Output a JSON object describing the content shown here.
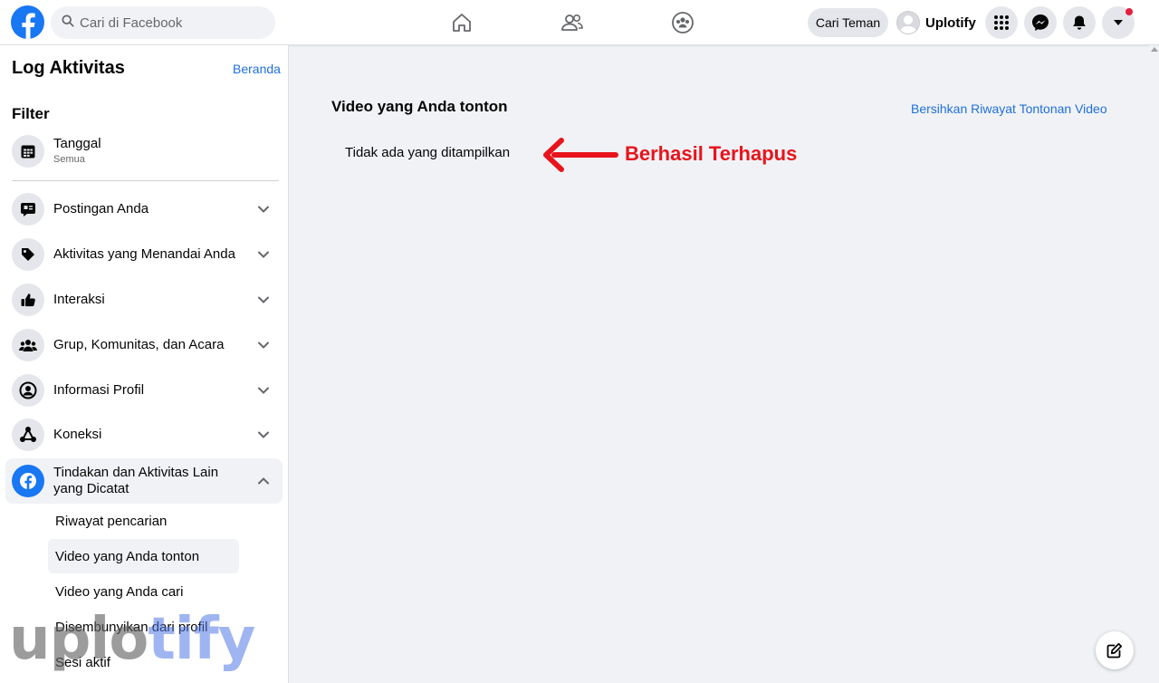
{
  "header": {
    "search_placeholder": "Cari di Facebook",
    "find_friends_label": "Cari Teman",
    "profile_name": "Uplotify",
    "nav": [
      "home-icon",
      "friends-icon",
      "groups-icon"
    ],
    "accent_color": "#1877f2",
    "notification_dot_color": "#e41e3f"
  },
  "sidebar": {
    "title": "Log Aktivitas",
    "home_link": "Beranda",
    "filter_title": "Filter",
    "date_filter": {
      "label": "Tanggal",
      "value": "Semua"
    },
    "categories": [
      {
        "label": "Postingan Anda",
        "icon": "post-icon"
      },
      {
        "label": "Aktivitas yang Menandai Anda",
        "icon": "tag-icon"
      },
      {
        "label": "Interaksi",
        "icon": "like-icon"
      },
      {
        "label": "Grup, Komunitas, dan Acara",
        "icon": "group-icon"
      },
      {
        "label": "Informasi Profil",
        "icon": "profile-icon"
      },
      {
        "label": "Koneksi",
        "icon": "connection-icon"
      },
      {
        "label": "Tindakan dan Aktivitas Lain yang Dicatat",
        "icon": "facebook-icon"
      }
    ],
    "subitems": [
      {
        "label": "Riwayat pencarian"
      },
      {
        "label": "Video yang Anda tonton",
        "active": true
      },
      {
        "label": "Video yang Anda cari"
      },
      {
        "label": "Disembunyikan dari profil"
      },
      {
        "label": "Sesi aktif"
      }
    ]
  },
  "main": {
    "title": "Video yang Anda tonton",
    "clear_link": "Bersihkan Riwayat Tontonan Video",
    "empty_text": "Tidak ada yang ditampilkan"
  },
  "annotation": {
    "text": "Berhasil Terhapus",
    "color": "#e8141c"
  },
  "watermark": {
    "part1": "uplo",
    "part2": "tify"
  }
}
